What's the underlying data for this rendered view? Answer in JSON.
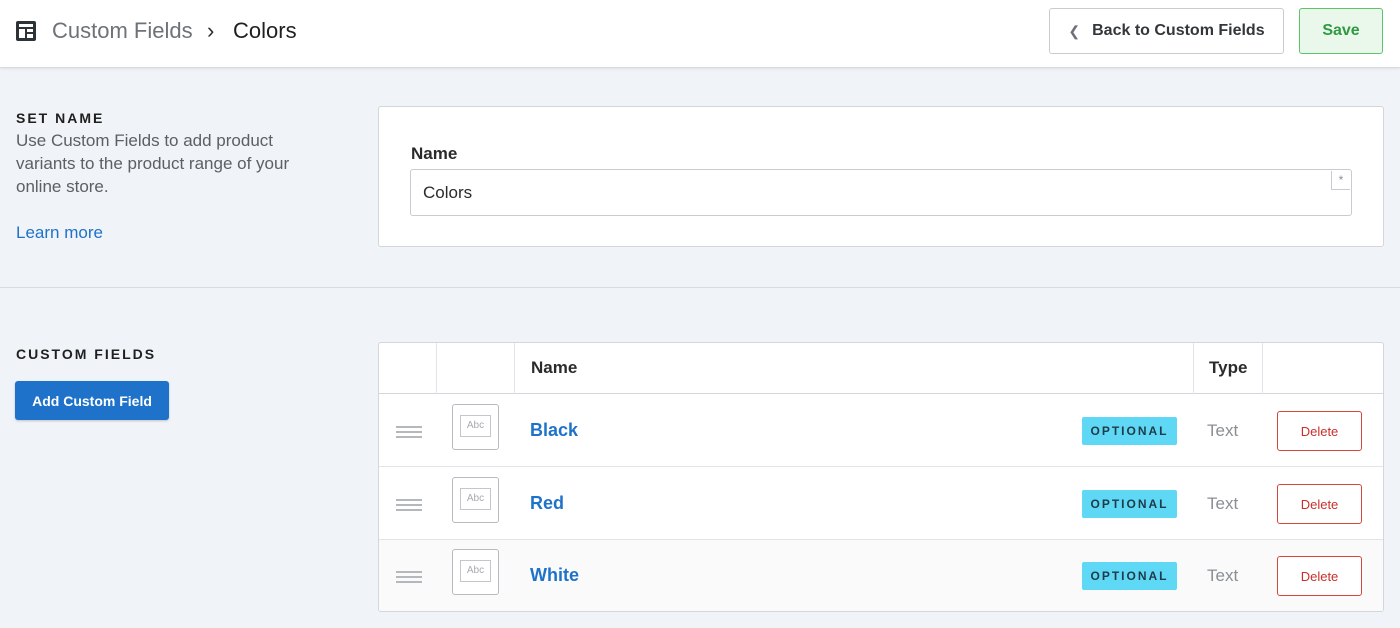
{
  "header": {
    "breadcrumb_parent": "Custom Fields",
    "breadcrumb_separator": "›",
    "breadcrumb_current": "Colors",
    "back_button_label": "Back to Custom Fields",
    "save_button_label": "Save"
  },
  "set_name": {
    "section_title": "SET NAME",
    "description": "Use Custom Fields to add product variants to the product range of your online store.",
    "learn_more_label": "Learn more",
    "name_label": "Name",
    "name_value": "Colors",
    "required_marker": "*"
  },
  "custom_fields": {
    "section_title": "CUSTOM FIELDS",
    "add_button_label": "Add Custom Field",
    "table": {
      "columns": [
        "",
        "",
        "Name",
        "Type",
        ""
      ],
      "rows": [
        {
          "icon_label": "Abc",
          "name": "Black",
          "badge": "OPTIONAL",
          "type": "Text",
          "delete_label": "Delete"
        },
        {
          "icon_label": "Abc",
          "name": "Red",
          "badge": "OPTIONAL",
          "type": "Text",
          "delete_label": "Delete"
        },
        {
          "icon_label": "Abc",
          "name": "White",
          "badge": "OPTIONAL",
          "type": "Text",
          "delete_label": "Delete"
        }
      ]
    }
  },
  "icons": {
    "app_icon": "layout-icon",
    "back_chevron": "chevron-left-icon",
    "drag_handle": "drag-handle-icon",
    "field_type": "text-field-icon"
  },
  "colors": {
    "primary_blue": "#1f72c9",
    "save_green": "#2f9a42",
    "badge_cyan": "#5fd8f5",
    "delete_red": "#c9302c"
  }
}
